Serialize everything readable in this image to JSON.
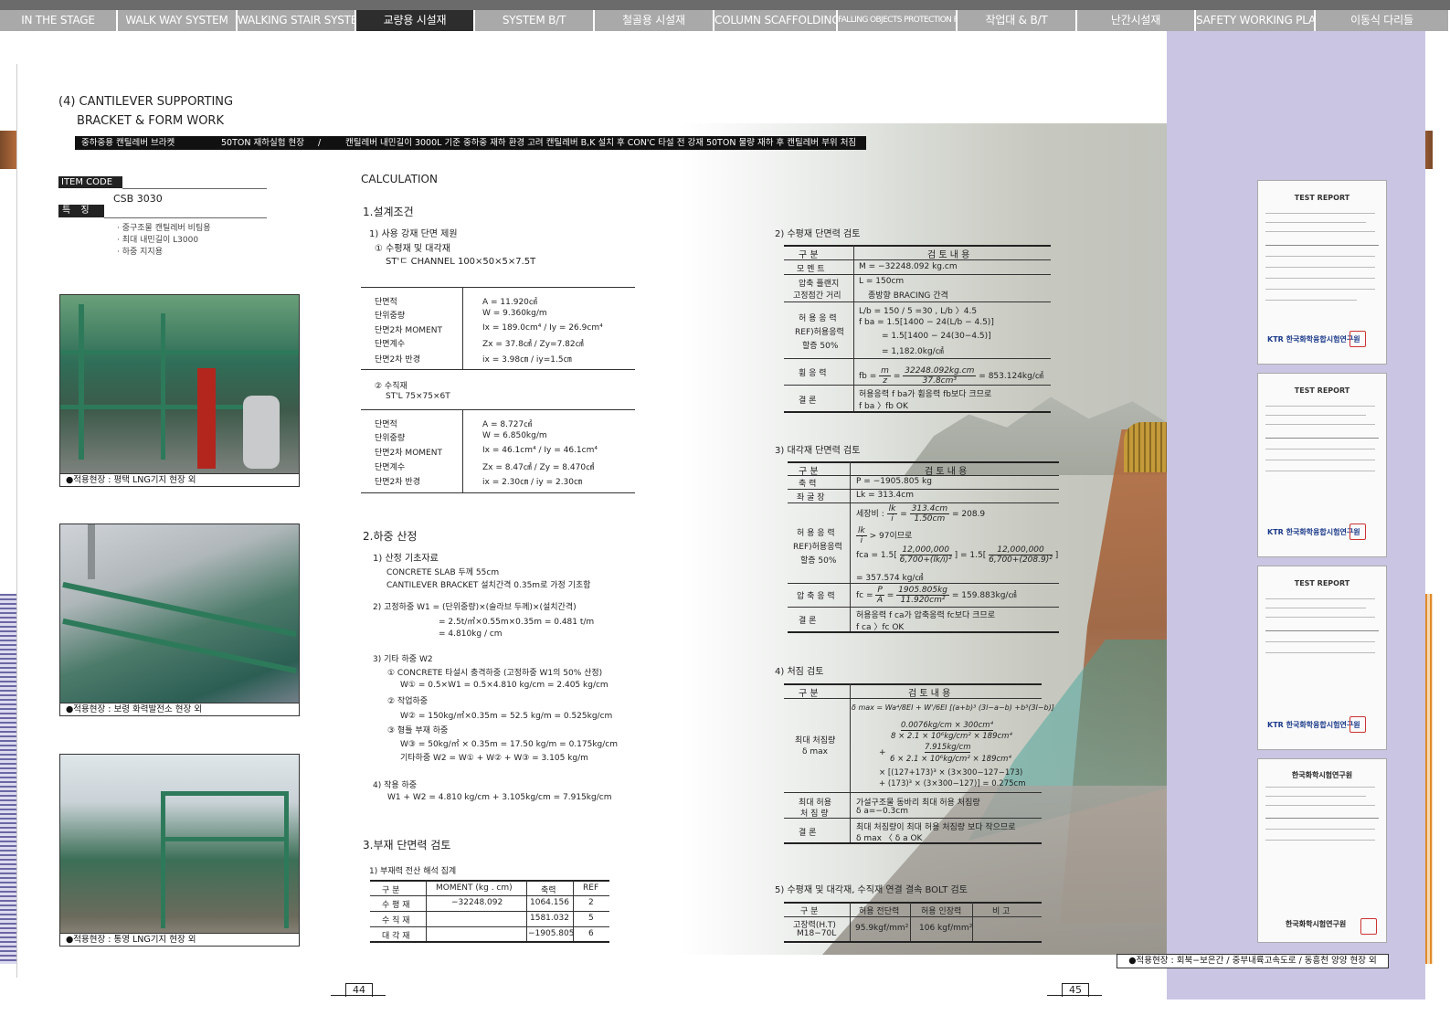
{
  "nav": {
    "tabs": [
      {
        "label": "IN THE STAGE",
        "active": false
      },
      {
        "label": "WALK WAY SYSTEM",
        "active": false
      },
      {
        "label": "WALKING STAIR SYSTEM",
        "active": false
      },
      {
        "label": "교량용 시설재",
        "active": true
      },
      {
        "label": "SYSTEM B/T",
        "active": false
      },
      {
        "label": "철골용 시설재",
        "active": false
      },
      {
        "label": "COLUMN SCAFFOLDING",
        "active": false
      },
      {
        "label": "FALLING OBJECTS PROTECTION PLATFORM",
        "active": false
      },
      {
        "label": "작업대 & B/T",
        "active": false
      },
      {
        "label": "난간시설재",
        "active": false
      },
      {
        "label": "SAFETY WORKING PLATFORM",
        "active": false
      },
      {
        "label": "이동식 다리들",
        "active": false
      }
    ]
  },
  "header": {
    "title_line1": "(4) CANTILEVER SUPPORTING",
    "title_line2": "BRACKET & FORM WORK",
    "banner_a": "중하중용 캔틸레버 브라켓",
    "banner_b": "50TON 재하실험 현장",
    "banner_sep": "/",
    "banner_c": "캔틸레버 내민길이 3000L 기준 중하중 재하 환경 고려 캔틸레버 B,K 설치 후 CON'C 타설 전 강재 50TON 물량 재하 후 캔틸레버 부위 처짐 변위 없음"
  },
  "item": {
    "code_label": "ITEM CODE",
    "code": "CSB 3030",
    "feature_label": "특 징",
    "features": [
      "· 중구조물 캔틸레버 비팀용",
      "· 최대 내민길이 L3000",
      "· 하중 지지용"
    ]
  },
  "photos": [
    {
      "caption": "●적용현장 : 평택 LNG기지 현장 외"
    },
    {
      "caption": "●적용현장 : 보령 화력발전소 현장 외"
    },
    {
      "caption": "●적용현장 : 통영 LNG기지 현장 외"
    }
  ],
  "calc": {
    "title": "CALCULATION",
    "s1": {
      "title": "1.설계조건",
      "sub1": "1) 사용 강재 단면 제원",
      "m1": "① 수평재 및 대각재",
      "m1_spec": "ST'ㄷ CHANNEL 100×50×5×7.5T",
      "table1": [
        {
          "k": "단면적",
          "v": "A = 11.920㎠"
        },
        {
          "k": "단위중량",
          "v": "W = 9.360kg/m"
        },
        {
          "k": "단면2차 MOMENT",
          "v": "Ix = 189.0cm⁴ / Iy = 26.9cm⁴"
        },
        {
          "k": "단면계수",
          "v": "Zx = 37.8㎤ / Zy=7.82㎤"
        },
        {
          "k": "단면2차 반경",
          "v": "ix = 3.98㎝ / iy=1.5㎝"
        }
      ],
      "m2": "② 수직재",
      "m2_spec": "ST'L 75×75×6T",
      "table2": [
        {
          "k": "단면적",
          "v": "A = 8.727㎠"
        },
        {
          "k": "단위중량",
          "v": "W = 6.850kg/m"
        },
        {
          "k": "단면2차 MOMENT",
          "v": "Ix = 46.1cm⁴ / Iy = 46.1cm⁴"
        },
        {
          "k": "단면계수",
          "v": "Zx = 8.47㎤ / Zy = 8.470㎤"
        },
        {
          "k": "단면2차 반경",
          "v": "ix = 2.30㎝ / iy = 2.30㎝"
        }
      ]
    },
    "s2": {
      "title": "2.하중 산정",
      "lines": [
        "1) 산정 기초자료",
        "CONCRETE SLAB 두께 55cm",
        "CANTILEVER BRACKET 설치간격 0.35m로 가정 기초함",
        "2) 고정하중 W1 = (단위중량)×(슬라브 두께)×(설치간격)",
        "= 2.5t/㎥×0.55m×0.35m = 0.481 t/m",
        "= 4.810kg / cm",
        "3) 기타 하중 W2",
        "① CONCRETE 타설시 충격하중 (고정하중 W1의 50% 산정)",
        "W① = 0.5×W1 = 0.5×4.810 kg/cm = 2.405 kg/cm",
        "② 작업하중",
        "W② = 150kg/㎡×0.35m = 52.5 kg/m = 0.525kg/cm",
        "③ 형틀 부재 하중",
        "W③ = 50kg/㎡ × 0.35m = 17.50 kg/m = 0.175kg/cm",
        "기타하중 W2 = W① + W② + W③ = 3.105 kg/m",
        "4) 작용 하중",
        "W1 + W2 = 4.810 kg/cm + 3.105kg/cm = 7.915kg/cm"
      ]
    },
    "s3": {
      "title": "3.부재 단면력 검토",
      "sub1": "1) 부재력 전산 해석 집계",
      "headers": [
        "구  분",
        "MOMENT (kg . cm)",
        "축력",
        "REF"
      ],
      "rows": [
        [
          "수 평 재",
          "−32248.092",
          "1064.156",
          "2"
        ],
        [
          "수 직 재",
          "",
          "1581.032",
          "5"
        ],
        [
          "대 각 재",
          "",
          "−1905.805",
          "6"
        ]
      ]
    }
  },
  "right": {
    "s2": {
      "title": "2) 수평재 단면력 검토",
      "h1": "구  분",
      "h2": "검 토 내 용",
      "r_moment_k": "모 멘 트",
      "r_moment_v": "M = −32248.092 kg.cm",
      "r_len_k1": "압축 플랜지",
      "r_len_k2": "고정점간 거리",
      "r_len_v1": "L = 150cm",
      "r_len_v2": "종방향 BRACING 간격",
      "r_allow_k1": "허 용 응 력",
      "r_allow_k2": "REF)허용응력",
      "r_allow_k3": "할증 50%",
      "r_allow_v1": "L/b = 150 / 5 =30 , L/b 〉4.5",
      "r_allow_v2": "f ba = 1.5[1400 − 24(L/b − 4.5)]",
      "r_allow_v3": "= 1.5[1400 − 24(30−4.5)]",
      "r_allow_v4": "= 1,182.0kg/㎠",
      "r_bend_k": "휨 응 력",
      "r_bend_v1": "fb =",
      "r_bend_num1": "m",
      "r_bend_den1": "z",
      "r_bend_num2": "32248.092kg.cm",
      "r_bend_den2": "37.8cm³",
      "r_bend_v2": "= 853.124kg/㎠",
      "r_con_k": "결  론",
      "r_con_v1": "허용응력 f ba가 휨응력 fb보다 크므로",
      "r_con_v2": "f ba 〉fb OK"
    },
    "s3": {
      "title": "3) 대각재 단면력 검토",
      "h1": "구  분",
      "h2": "검 토 내 용",
      "r_axial_k": "축    력",
      "r_axial_v": "P = −1905.805 kg",
      "r_buck_k": "좌 굴 장",
      "r_buck_v": "Lk = 313.4cm",
      "r_allow_k1": "허 용 응 력",
      "r_allow_k2": "REF)허용응력",
      "r_allow_k3": "할증 50%",
      "r_slender": "세장비 :",
      "r_slender_num": "lk",
      "r_slender_den": "i",
      "r_slender_num2": "313.4cm",
      "r_slender_den2": "1.50cm",
      "r_slender_v": "= 208.9",
      "r_97": "> 97이므로",
      "r_fca": "fca = 1.5[",
      "r_fca_num": "12,000,000",
      "r_fca_den": "6,700+(lk/i)²",
      "r_fca_mid": "] = 1.5[",
      "r_fca_num2": "12,000,000",
      "r_fca_den2": "6,700+(208.9)²",
      "r_fca_end": "]",
      "r_fca_res": "= 357.574 kg/㎠",
      "r_comp_k": "압 축 응 력",
      "r_comp_v1": "fc =",
      "r_comp_num1": "P",
      "r_comp_den1": "A",
      "r_comp_num2": "1905.805kg",
      "r_comp_den2": "11.920cm²",
      "r_comp_v2": "= 159.883kg/㎠",
      "r_con_k": "결  론",
      "r_con_v1": "허용응력 f ca가 압축응력 fc보다 크므로",
      "r_con_v2": "f ca 〉fc OK"
    },
    "s4": {
      "title": "4) 처짐 검토",
      "h1": "구  분",
      "h2": "검 토 내 용",
      "r_max_k1": "최대 처짐량",
      "r_max_k2": "δ  max",
      "f1": "δ max = Wa⁴/8EI + W'/6EI [(a+b)³ (3l−a−b) +b³(3l−b)]",
      "f2": "0.0076kg/cm × 300cm⁴",
      "f3": "8 × 2.1 × 10⁶kg/cm² × 189cm⁴",
      "f4": "7.915kg/cm",
      "f5": "6 × 2.1 × 10⁶kg/cm² × 189cm⁴",
      "f6": "× [(127+173)³ × (3×300−127−173)",
      "f7": "+ (173)³ × (3×300−127)] = 0.275cm",
      "r_allow_k1": "최대 허용",
      "r_allow_k2": "처 짐 량",
      "r_allow_v1": "가설구조물 동바리 최대 허용 처짐량",
      "r_allow_v2": "δ a=−0.3cm",
      "r_con_k": "결  론",
      "r_con_v1": "최대 처짐량이 최대 허용 처짐량 보다 작으므로",
      "r_con_v2": "δ  max 〈 δ a    OK"
    },
    "s5": {
      "title": "5) 수평재 및 대각재, 수직재 연결 결속 BOLT 검토",
      "headers": [
        "구  분",
        "허용 전단력",
        "허용 인장력",
        "비  고"
      ],
      "row_k1": "고장력(H.T)",
      "row_k2": "M18−70L",
      "row_v1": "95.9kgf/mm²",
      "row_v2": "106 kgf/mm²",
      "row_v3": ""
    }
  },
  "reports": [
    {
      "title": "TEST REPORT",
      "brand": "KTR 한국화학융합시험연구원"
    },
    {
      "title": "TEST REPORT",
      "brand": "KTR 한국화학융합시험연구원"
    },
    {
      "title": "TEST REPORT",
      "brand": "KTR 한국화학융합시험연구원"
    },
    {
      "title": "한국화학시험연구원",
      "brand": "한국화학시험연구원"
    }
  ],
  "bottom_caption": "●적용현장 : 회북−보은간 / 중부내륙고속도로 / 동흥천 양양 현장 외",
  "pages": {
    "left": "44",
    "right": "45"
  },
  "colors": {
    "nav_active": "#2d2d2d",
    "nav_tab": "#a9a9a9",
    "lavender": "#c9c5e2",
    "accent_orange": "#e08a2a",
    "accent_purple": "#6b67a3"
  }
}
